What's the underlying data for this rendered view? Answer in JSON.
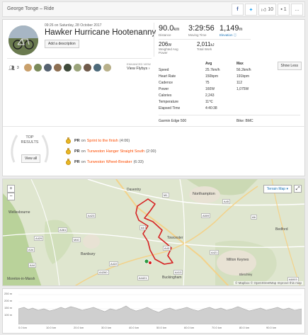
{
  "header": {
    "title": "George Tonge – Ride",
    "kudos_count": "10",
    "comment_count": "1",
    "share_icons": [
      "facebook-icon",
      "twitter-icon"
    ]
  },
  "activity": {
    "date": "09:26 on Saturday, 28 October 2017",
    "title": "Hawker Hurricane Hootenanny",
    "add_description": "Add a description"
  },
  "stats": {
    "distance_value": "90.0",
    "distance_unit": "km",
    "distance_label": "Distance",
    "moving_time_value": "3:29:56",
    "moving_time_label": "Moving Time",
    "elevation_value": "1,149",
    "elevation_unit": "m",
    "elevation_label": "Elevation",
    "power_value": "206",
    "power_unit": "W",
    "power_label": "Weighted Avg Power",
    "work_value": "2,011",
    "work_unit": "kJ",
    "work_label": "Total Work"
  },
  "social": {
    "athlete_count": "3",
    "flyby_label": "ENHANCED VIEW",
    "flyby_link": "View Flybys"
  },
  "details": {
    "show_less": "Show Less",
    "col_avg": "Avg",
    "col_max": "Max",
    "rows": [
      {
        "label": "Speed",
        "avg": "25.7km/h",
        "max": "56.2km/h"
      },
      {
        "label": "Heart Rate",
        "avg": "150bpm",
        "max": "191bpm"
      },
      {
        "label": "Cadence",
        "avg": "75",
        "max": "112"
      },
      {
        "label": "Power",
        "avg": "160W",
        "max": "1,075W"
      },
      {
        "label": "Calories",
        "avg": "2,243",
        "max": ""
      },
      {
        "label": "Temperature",
        "avg": "11℃",
        "max": ""
      },
      {
        "label": "Elapsed Time",
        "avg": "4:40:38",
        "max": ""
      }
    ],
    "device": "Garmin Edge 500",
    "bike": "Bike: BMC"
  },
  "top_results": {
    "title_line1": "TOP",
    "title_line2": "RESULTS",
    "view_all": "View all",
    "items": [
      {
        "tag": "PR",
        "on": "on",
        "segment": "Sprint to the finish",
        "time": "(4:06)"
      },
      {
        "tag": "PR",
        "on": "on",
        "segment": "Turweston Hanger Straight South",
        "time": "(2:00)"
      },
      {
        "tag": "PR",
        "on": "on",
        "segment": "Turweston Wheel-Breaker",
        "time": "(6:33)"
      }
    ]
  },
  "map": {
    "terrain_button": "Terrain Map ▾",
    "zoom_in": "+",
    "zoom_out": "−",
    "attribution": "© Mapbox © OpenStreetMap Improve this map",
    "places": [
      {
        "name": "Daventry"
      },
      {
        "name": "Northampton"
      },
      {
        "name": "Wellesbourne"
      },
      {
        "name": "Towcester"
      },
      {
        "name": "Banbury"
      },
      {
        "name": "Buckingham"
      },
      {
        "name": "Milton Keynes"
      },
      {
        "name": "Bedford"
      },
      {
        "name": "Moreton-in-Marsh"
      },
      {
        "name": "Bletchley"
      }
    ],
    "road_labels": [
      "M1",
      "A45",
      "A5",
      "A43",
      "A422",
      "A413",
      "A421",
      "A509",
      "A6",
      "A428",
      "A361",
      "A44",
      "A429",
      "A34",
      "A4260",
      "A423",
      "A4421",
      "M40",
      "A6003"
    ]
  },
  "elevation": {
    "y_labels": [
      "250 m",
      "200 m",
      "150 m",
      "100 m"
    ],
    "x_labels": [
      "0.0 km",
      "10.0 km",
      "20.0 km",
      "30.0 km",
      "40.0 km",
      "50.0 km",
      "60.0 km",
      "70.0 km",
      "80.0 km",
      "90.0 km"
    ]
  },
  "colors": {
    "accent": "#fc4c02",
    "link": "#1a73b5",
    "route": "#d62222"
  }
}
